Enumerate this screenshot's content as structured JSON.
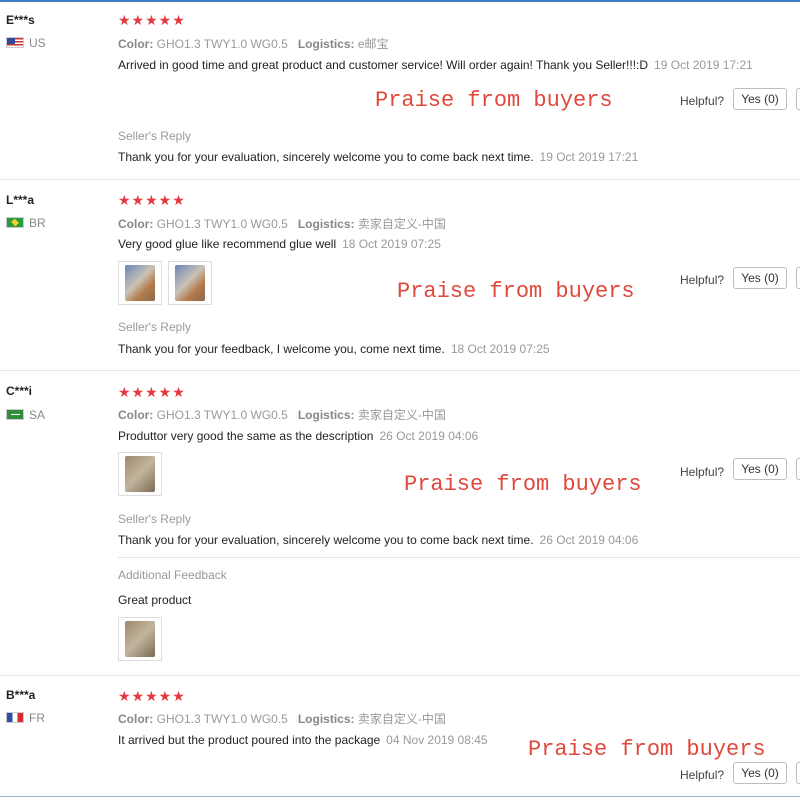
{
  "labels": {
    "color": "Color:",
    "logistics": "Logistics:",
    "sellers_reply": "Seller's Reply",
    "additional_feedback": "Additional Feedback",
    "helpful": "Helpful?",
    "yes_button": "Yes (0)",
    "stars": "★★★★★"
  },
  "watermark": "Praise from buyers",
  "reviews": [
    {
      "user": "E***s",
      "country": "US",
      "flag_icon": "us-flag-icon",
      "rating": 5,
      "color_value": "GHO1.3 TWY1.0 WG0.5",
      "logistics_value": "e邮宝",
      "text": "Arrived in good time and great product and customer service! Will order again! Thank you Seller!!!:D",
      "date": "19 Oct 2019 17:21",
      "reply": "Thank you for your evaluation, sincerely welcome you to come back next time.",
      "reply_date": "19 Oct 2019 17:21"
    },
    {
      "user": "L***a",
      "country": "BR",
      "flag_icon": "br-flag-icon",
      "rating": 5,
      "color_value": "GHO1.3 TWY1.0 WG0.5",
      "logistics_value": "卖家自定义-中国",
      "text": "Very good glue like recommend glue well",
      "date": "18 Oct 2019 07:25",
      "photos": [
        "product-photo",
        "product-photo"
      ],
      "reply": "Thank you for your feedback, I welcome you, come next time.",
      "reply_date": "18 Oct 2019 07:25"
    },
    {
      "user": "C***i",
      "country": "SA",
      "flag_icon": "sa-flag-icon",
      "rating": 5,
      "color_value": "GHO1.3 TWY1.0 WG0.5",
      "logistics_value": "卖家自定义-中国",
      "text": "Produttor very good the same as the description",
      "date": "26 Oct 2019 04:06",
      "photos": [
        "product-photo"
      ],
      "reply": "Thank you for your evaluation, sincerely welcome you to come back next time.",
      "reply_date": "26 Oct 2019 04:06",
      "additional_feedback": "Great product",
      "additional_photos": [
        "product-photo"
      ]
    },
    {
      "user": "B***a",
      "country": "FR",
      "flag_icon": "fr-flag-icon",
      "rating": 5,
      "color_value": "GHO1.3 TWY1.0 WG0.5",
      "logistics_value": "卖家自定义-中国",
      "text": "It arrived but the product poured into the package",
      "date": "04 Nov 2019 08:45"
    }
  ],
  "colors": {
    "stars": "#e5383f",
    "watermark": "#e0483c",
    "muted": "#999999",
    "divider": "#e5e5e5"
  }
}
